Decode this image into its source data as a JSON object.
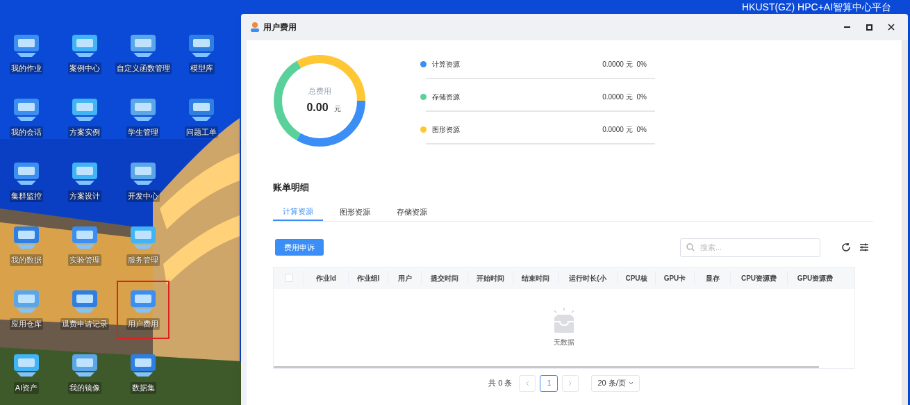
{
  "desktop": {
    "platform_title": "HKUST(GZ) HPC+AI智算中心平台",
    "icons": [
      {
        "label": "我的作业",
        "selected": false
      },
      {
        "label": "案例中心",
        "selected": false
      },
      {
        "label": "自定义函数管理",
        "selected": false
      },
      {
        "label": "模型库",
        "selected": false
      },
      {
        "label": "我的会话",
        "selected": false
      },
      {
        "label": "方案实例",
        "selected": false
      },
      {
        "label": "学生管理",
        "selected": false
      },
      {
        "label": "问题工单",
        "selected": false
      },
      {
        "label": "集群监控",
        "selected": false
      },
      {
        "label": "方案设计",
        "selected": false
      },
      {
        "label": "开发中心",
        "selected": false
      },
      {
        "label": "我的数据",
        "selected": false
      },
      {
        "label": "实验管理",
        "selected": false
      },
      {
        "label": "服务管理",
        "selected": false
      },
      {
        "label": "应用仓库",
        "selected": false
      },
      {
        "label": "退费申请记录",
        "selected": false
      },
      {
        "label": "用户费用",
        "selected": true
      },
      {
        "label": "AI资产",
        "selected": false
      },
      {
        "label": "我的镜像",
        "selected": false
      },
      {
        "label": "数据集",
        "selected": false
      }
    ]
  },
  "window": {
    "title": "用户费用",
    "summary": {
      "label": "总费用",
      "value": "0.00",
      "unit": "元",
      "items": [
        {
          "name": "计算资源",
          "color": "#3a8ef6",
          "amount": "0.0000 元",
          "percent": "0%"
        },
        {
          "name": "存储资源",
          "color": "#5ad19a",
          "amount": "0.0000 元",
          "percent": "0%"
        },
        {
          "name": "图形资源",
          "color": "#fec733",
          "amount": "0.0000 元",
          "percent": "0%"
        }
      ]
    },
    "section_title": "账单明细",
    "tabs": [
      {
        "label": "计算资源",
        "selected": true
      },
      {
        "label": "图形资源",
        "selected": false
      },
      {
        "label": "存储资源",
        "selected": false
      }
    ],
    "appeal_button": "费用申诉",
    "search": {
      "placeholder": "搜索..."
    },
    "table": {
      "select_all": {
        "checked": false
      },
      "columns": [
        "作业Id",
        "作业组I",
        "用户",
        "提交时间",
        "开始时间",
        "结束时间",
        "运行时长(小",
        "CPU核",
        "GPU卡",
        "显存",
        "CPU资源费",
        "GPU资源费"
      ],
      "empty": "无数据"
    },
    "pagination": {
      "total": "共 0 条",
      "pages": [
        {
          "label": "1",
          "selected": true
        }
      ],
      "page_size": "20 条/页"
    }
  }
}
